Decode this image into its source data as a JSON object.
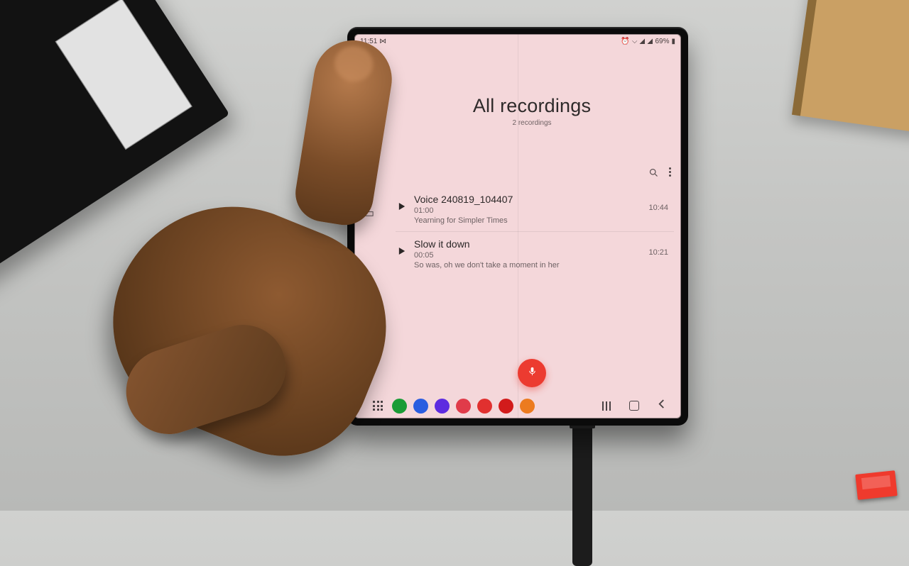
{
  "status_bar": {
    "time": "11:51",
    "icon_label": "⋈",
    "battery_text": "69%"
  },
  "sidebar_icons": [
    "waveform-icon",
    "mic-icon",
    "trash-icon",
    "folder-icon",
    "folder-outline-icon"
  ],
  "header": {
    "title": "All recordings",
    "subtitle": "2 recordings"
  },
  "recordings": [
    {
      "name": "Voice 240819_104407",
      "duration": "01:00",
      "summary": "Yearning for Simpler Times",
      "time": "10:44"
    },
    {
      "name": "Slow it down",
      "duration": "00:05",
      "summary": "So was, oh we don't take a moment in her",
      "time": "10:21"
    }
  ],
  "dock_colors": [
    "#1a9c36",
    "#2a5de0",
    "#5d2be0",
    "#e03b4a",
    "#e1302f",
    "#d21b1b",
    "#ec7b1f"
  ]
}
